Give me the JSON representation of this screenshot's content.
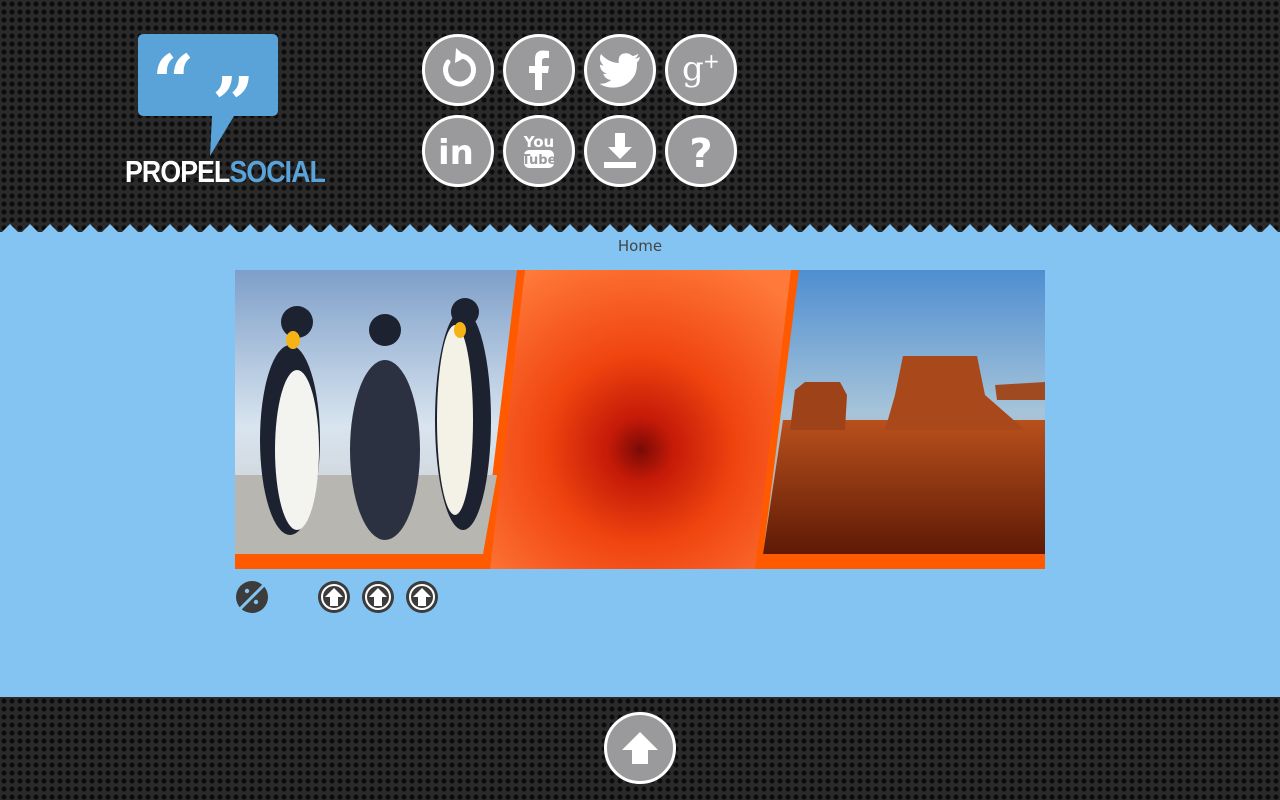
{
  "logo": {
    "word1": "PROPEL",
    "word2": "SOCIAL"
  },
  "social_buttons": [
    {
      "name": "refresh-icon"
    },
    {
      "name": "facebook-icon"
    },
    {
      "name": "twitter-icon"
    },
    {
      "name": "google-plus-icon"
    },
    {
      "name": "linkedin-icon"
    },
    {
      "name": "youtube-icon"
    },
    {
      "name": "download-icon"
    },
    {
      "name": "help-icon"
    }
  ],
  "breadcrumb": {
    "label": "Home"
  },
  "slideshow": {
    "slides": [
      "penguins-image",
      "orange-flower-image",
      "desert-mesa-image"
    ],
    "pager_count": 3
  },
  "colors": {
    "header_bg": "#2a2a2a",
    "main_bg": "#84c4f2",
    "accent_orange": "#ff5a00",
    "logo_blue": "#5aa3d8",
    "button_grey": "#9a9a9d"
  }
}
